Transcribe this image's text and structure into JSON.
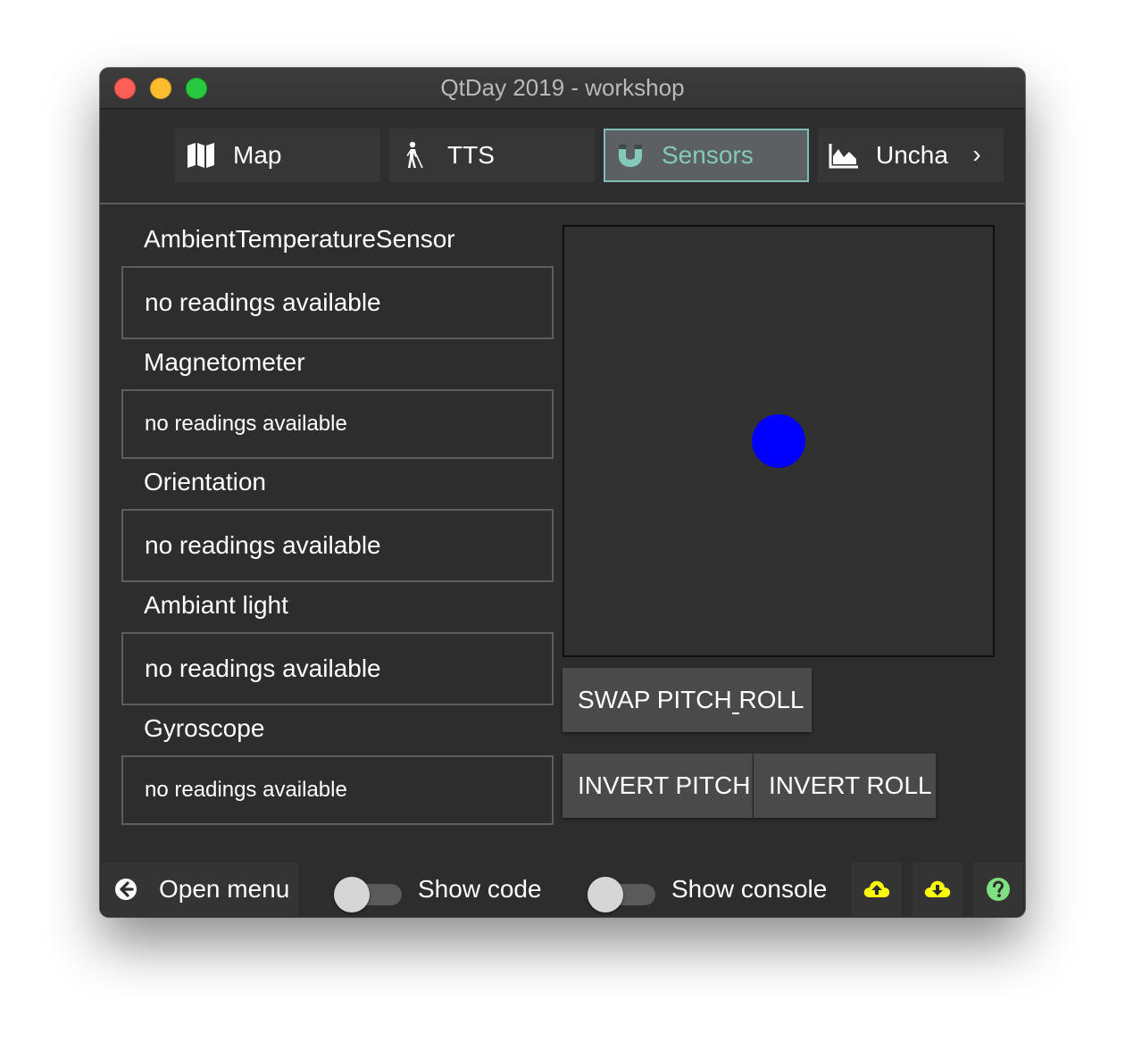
{
  "window": {
    "title": "QtDay 2019 - workshop"
  },
  "tabs": [
    {
      "label": "Map",
      "icon": "map-icon",
      "active": false
    },
    {
      "label": "TTS",
      "icon": "blind-person-icon",
      "active": false
    },
    {
      "label": "Sensors",
      "icon": "magnet-icon",
      "active": true
    },
    {
      "label": "Uncha",
      "icon": "area-chart-icon",
      "active": false
    }
  ],
  "tab_scroll": {
    "icon": "chevron-right-icon",
    "glyph": "›"
  },
  "sensors": [
    {
      "name": "AmbientTemperatureSensor",
      "value": "no readings available"
    },
    {
      "name": "Magnetometer",
      "value": "no readings available"
    },
    {
      "name": "Orientation",
      "value": "no readings available"
    },
    {
      "name": "Ambiant light",
      "value": "no readings available"
    },
    {
      "name": "Gyroscope",
      "value": "no readings available"
    }
  ],
  "tilt_canvas": {
    "dot_color": "#0000ff"
  },
  "buttons": {
    "swap": "SWAP PITCH ROLL",
    "invert_pitch": "INVERT PITCH",
    "invert_roll": "INVERT ROLL"
  },
  "bottom": {
    "open_menu": "Open menu",
    "show_code": "Show code",
    "show_code_on": false,
    "show_console": "Show console",
    "show_console_on": false,
    "upload_icon": "cloud-upload-icon",
    "download_icon": "cloud-download-icon",
    "help_icon": "help-icon"
  },
  "colors": {
    "accent": "#84c8ba",
    "background": "#2d2d2d",
    "cloud_icons": "#ffff00",
    "help_icon": "#7ee07e"
  }
}
